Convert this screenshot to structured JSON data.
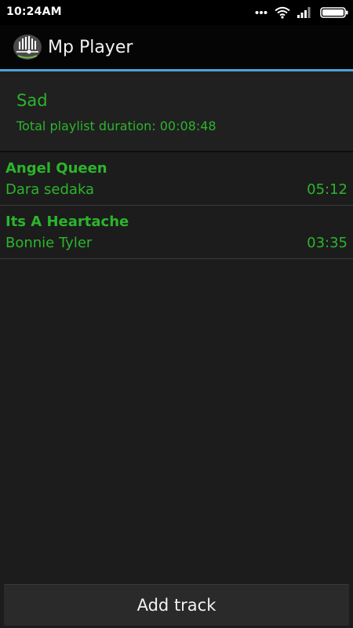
{
  "status_bar": {
    "time": "10:24AM"
  },
  "app": {
    "title": "Mp Player"
  },
  "playlist": {
    "name": "Sad",
    "duration_label": "Total playlist duration: 00:08:48"
  },
  "tracks": [
    {
      "title": "Angel Queen",
      "artist": "Dara sedaka",
      "duration": "05:12"
    },
    {
      "title": "Its A Heartache",
      "artist": "Bonnie Tyler",
      "duration": "03:35"
    }
  ],
  "actions": {
    "add_track_label": "Add track"
  },
  "colors": {
    "accent_green": "#2bb52b",
    "divider_blue": "#4aa5d6",
    "background": "#1c1c1c"
  },
  "icons": [
    "more-dots-icon",
    "wifi-icon",
    "signal-icon",
    "battery-icon",
    "app-logo-icon"
  ]
}
